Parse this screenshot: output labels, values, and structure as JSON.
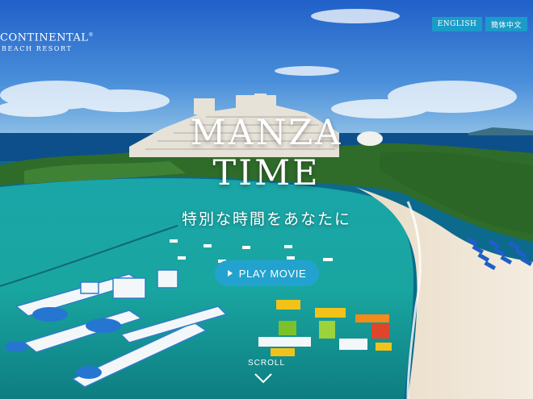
{
  "brand": {
    "name": "CONTINENTAL",
    "mark": "®",
    "sub": "BEACH RESORT"
  },
  "nav": {
    "lang_en": "ENGLISH",
    "lang_cn": "簡体中文"
  },
  "hero": {
    "title_line1": "MANZA",
    "title_line2": "TIME",
    "tagline": "特別な時間をあなたに",
    "play_label": "PLAY MOVIE",
    "scroll_label": "SCROLL"
  },
  "colors": {
    "accent": "#1a9cc8",
    "sky": "#2c6fcf",
    "sea": "#17a9a6",
    "sand": "#efe4d2"
  },
  "icons": {
    "play": "play-icon",
    "scroll": "chevron-down-icon"
  }
}
